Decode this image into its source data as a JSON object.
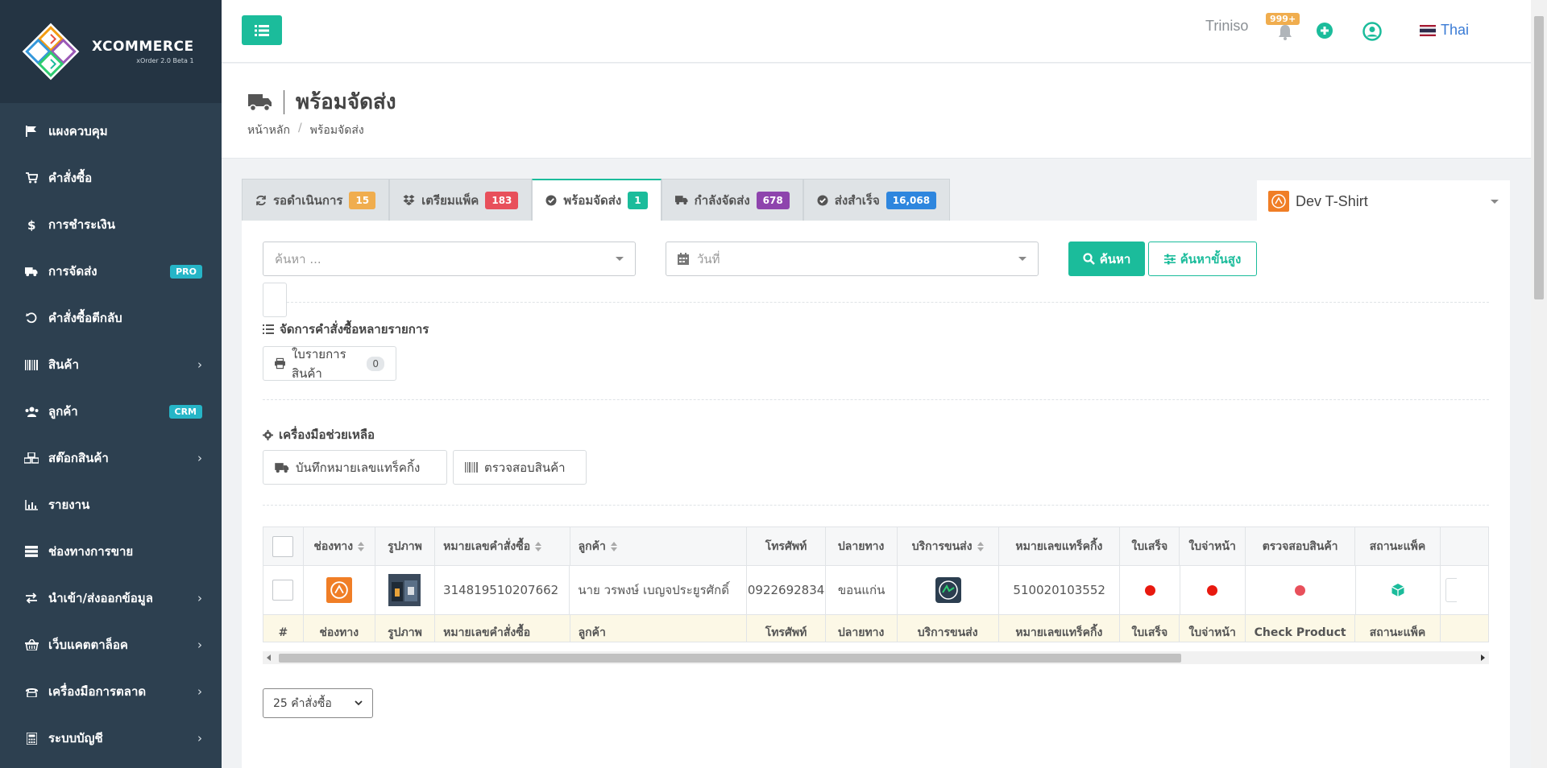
{
  "app": {
    "logo_name": "XCOMMERCE",
    "logo_version": "xOrder 2.0 Beta 1"
  },
  "sidebar": {
    "items": [
      {
        "label": "แผงควบคุม",
        "icon": "flag-icon",
        "badge": "",
        "chevron": false
      },
      {
        "label": "คำสั่งซื้อ",
        "icon": "cart-icon",
        "badge": "",
        "chevron": false
      },
      {
        "label": "การชำระเงิน",
        "icon": "dollar-icon",
        "badge": "",
        "chevron": false
      },
      {
        "label": "การจัดส่ง",
        "icon": "truck-icon",
        "badge": "PRO",
        "chevron": false
      },
      {
        "label": "คำสั่งซื้อตีกลับ",
        "icon": "undo-icon",
        "badge": "",
        "chevron": false
      },
      {
        "label": "สินค้า",
        "icon": "barcode-icon",
        "badge": "",
        "chevron": true
      },
      {
        "label": "ลูกค้า",
        "icon": "users-icon",
        "badge": "CRM",
        "chevron": false
      },
      {
        "label": "สต๊อกสินค้า",
        "icon": "cubes-icon",
        "badge": "",
        "chevron": true
      },
      {
        "label": "รายงาน",
        "icon": "bar-chart-icon",
        "badge": "",
        "chevron": false
      },
      {
        "label": "ช่องทางการขาย",
        "icon": "server-icon",
        "badge": "",
        "chevron": false
      },
      {
        "label": "นำเข้า/ส่งออกข้อมูล",
        "icon": "exchange-icon",
        "badge": "",
        "chevron": true
      },
      {
        "label": "เว็บแคตตาล็อค",
        "icon": "basket-icon",
        "badge": "",
        "chevron": true
      },
      {
        "label": "เครื่องมือการตลาด",
        "icon": "phone-icon",
        "badge": "",
        "chevron": true
      },
      {
        "label": "ระบบบัญชี",
        "icon": "calculator-icon",
        "badge": "",
        "chevron": true
      }
    ]
  },
  "topbar": {
    "user_name": "Triniso",
    "notification_badge": "999+",
    "language": "Thai"
  },
  "page": {
    "title": "พร้อมจัดส่ง",
    "breadcrumb": [
      "หน้าหลัก",
      "พร้อมจัดส่ง"
    ]
  },
  "tabs": [
    {
      "label": "รอดำเนินการ",
      "count": "15",
      "color": "#f0ad4e",
      "icon": "refresh-icon",
      "active": false
    },
    {
      "label": "เตรียมแพ็ค",
      "count": "183",
      "color": "#e8505b",
      "icon": "dropbox-icon",
      "active": false
    },
    {
      "label": "พร้อมจัดส่ง",
      "count": "1",
      "color": "#1bbc9b",
      "icon": "check-circle-icon",
      "active": true
    },
    {
      "label": "กำลังจัดส่ง",
      "count": "678",
      "color": "#8e44ad",
      "icon": "truck-icon",
      "active": false
    },
    {
      "label": "ส่งสำเร็จ",
      "count": "16,068",
      "color": "#2e86de",
      "icon": "check-circle-icon",
      "active": false
    }
  ],
  "shop_select": {
    "value": "Dev T-Shirt"
  },
  "search": {
    "placeholder": "ค้นหา ...",
    "date_placeholder": "วันที่",
    "search_button": "ค้นหา",
    "advanced_button": "ค้นหาขั้นสูง"
  },
  "bulk": {
    "title": "จัดการคำสั่งซื้อหลายรายการ",
    "print_button": "ใบรายการสินค้า",
    "print_count": "0"
  },
  "tools": {
    "title": "เครื่องมือช่วยเหลือ",
    "tracking_button": "บันทึกหมายเลขแทร็คกิ้ง",
    "check_button": "ตรวจสอบสินค้า"
  },
  "table": {
    "headers": [
      "",
      "ช่องทาง",
      "รูปภาพ",
      "หมายเลขคำสั่งซื้อ",
      "ลูกค้า",
      "โทรศัพท์",
      "ปลายทาง",
      "บริการขนส่ง",
      "หมายเลขแทร็คกิ้ง",
      "ใบเสร็จ",
      "ใบจ่าหน้า",
      "ตรวจสอบสินค้า",
      "สถานะแพ็ค"
    ],
    "footer": [
      "#",
      "ช่องทาง",
      "รูปภาพ",
      "หมายเลขคำสั่งซื้อ",
      "ลูกค้า",
      "โทรศัพท์",
      "ปลายทาง",
      "บริการขนส่ง",
      "หมายเลขแทร็คกิ้ง",
      "ใบเสร็จ",
      "ใบจ่าหน้า",
      "Check Product",
      "สถานะแพ็ค"
    ],
    "rows": [
      {
        "order_no": "314819510207662",
        "customer": "นาย วรพงษ์ เบญจประยูรศักดิ์",
        "phone": "0922692834",
        "destination": "ขอนแก่น",
        "tracking": "510020103552"
      }
    ]
  },
  "pagination": {
    "per_page": "25 คำสั่งซื้อ"
  }
}
